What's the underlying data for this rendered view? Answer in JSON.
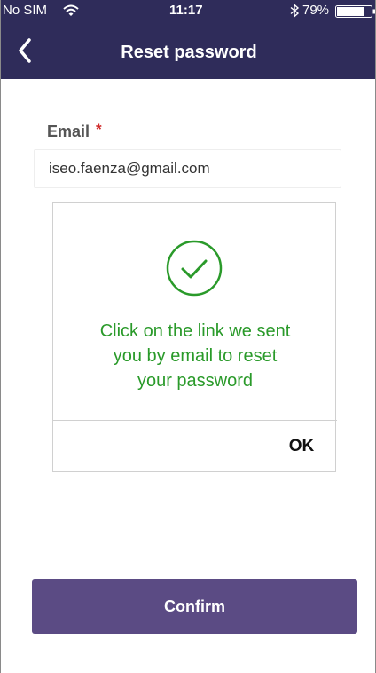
{
  "status_bar": {
    "carrier": "No SIM",
    "time": "11:17",
    "battery_percent": "79%",
    "battery_level": 0.79,
    "icons": [
      "wifi-icon",
      "bluetooth-icon",
      "battery-icon"
    ]
  },
  "nav": {
    "title": "Reset password",
    "back_icon": "chevron-left-icon"
  },
  "form": {
    "email_label": "Email",
    "required_marker": "*",
    "email_value": "iseo.faenza@gmail.com"
  },
  "dialog": {
    "icon": "check-circle-icon",
    "message_lines": [
      "Click on the link we sent",
      "you by email to reset",
      "your password"
    ],
    "ok_label": "OK"
  },
  "actions": {
    "confirm_label": "Confirm"
  },
  "colors": {
    "header_bg": "#2f2c5a",
    "button_bg": "#5b4b84",
    "success_green": "#2a9a2a",
    "required_red": "#d02828"
  }
}
